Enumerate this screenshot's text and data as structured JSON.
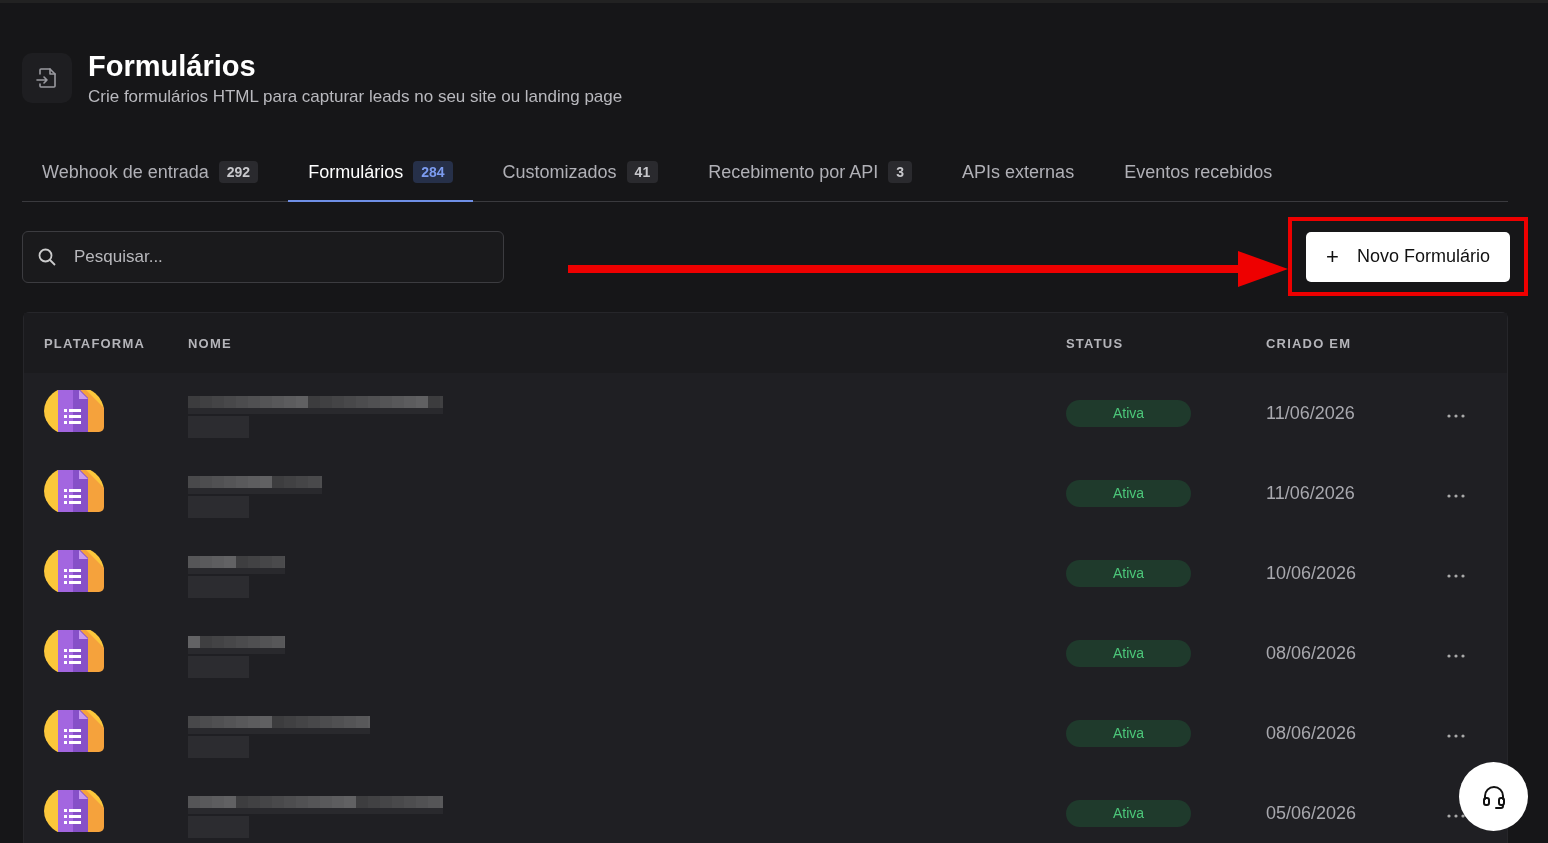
{
  "header": {
    "title": "Formulários",
    "subtitle": "Crie formulários HTML para capturar leads no seu site ou landing page"
  },
  "tabs": [
    {
      "label": "Webhook de entrada",
      "count": "292",
      "selected": false
    },
    {
      "label": "Formulários",
      "count": "284",
      "selected": true
    },
    {
      "label": "Customizados",
      "count": "41",
      "selected": false
    },
    {
      "label": "Recebimento por API",
      "count": "3",
      "selected": false
    },
    {
      "label": "APIs externas",
      "selected": false
    },
    {
      "label": "Eventos recebidos",
      "selected": false
    }
  ],
  "search": {
    "placeholder": "Pesquisar..."
  },
  "new_button": {
    "icon": "+",
    "label": "Novo Formulário"
  },
  "table": {
    "columns": [
      "PLATAFORMA",
      "NOME",
      "STATUS",
      "CRIADO EM"
    ],
    "rows": [
      {
        "status": "Ativa",
        "created": "11/06/2026"
      },
      {
        "status": "Ativa",
        "created": "11/06/2026"
      },
      {
        "status": "Ativa",
        "created": "10/06/2026"
      },
      {
        "status": "Ativa",
        "created": "08/06/2026"
      },
      {
        "status": "Ativa",
        "created": "08/06/2026"
      },
      {
        "status": "Ativa",
        "created": "05/06/2026"
      }
    ]
  }
}
